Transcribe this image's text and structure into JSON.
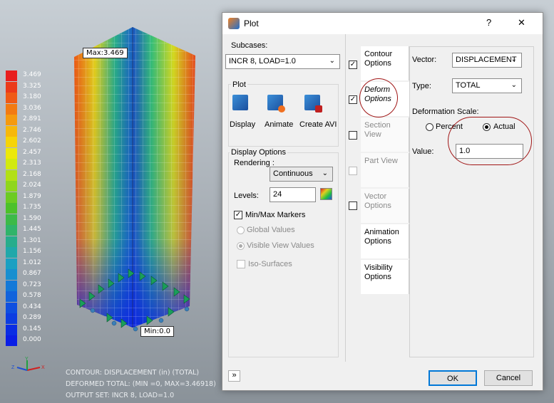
{
  "legend": {
    "values": [
      "3.469",
      "3.325",
      "3.180",
      "3.036",
      "2.891",
      "2.746",
      "2.602",
      "2.457",
      "2.313",
      "2.168",
      "2.024",
      "1.879",
      "1.735",
      "1.590",
      "1.445",
      "1.301",
      "1.156",
      "1.012",
      "0.867",
      "0.723",
      "0.578",
      "0.434",
      "0.289",
      "0.145",
      "0.000"
    ],
    "colors": [
      "#e81e1e",
      "#eb3a1a",
      "#ef5a16",
      "#f27a12",
      "#f59a0e",
      "#f7b80a",
      "#f6d407",
      "#ece80a",
      "#d2ea10",
      "#b2e016",
      "#8fd61c",
      "#6ccb22",
      "#4cc12a",
      "#3cba48",
      "#30b46a",
      "#27ad8c",
      "#20a8aa",
      "#1aa0c2",
      "#178fd0",
      "#1479d8",
      "#1163dc",
      "#0e4fe0",
      "#0c3de2",
      "#0a2de4",
      "#0a1ee6"
    ]
  },
  "markers": {
    "max_label": "Max:3.469",
    "min_label": "Min:0.0"
  },
  "info_lines": [
    "CONTOUR: DISPLACEMENT (in) (TOTAL)",
    "DEFORMED TOTAL: (MIN    =0, MAX=3.46918)",
    "OUTPUT SET: INCR 8, LOAD=1.0"
  ],
  "dialog": {
    "title": "Plot",
    "help": "?",
    "close": "✕",
    "subcases_label": "Subcases:",
    "subcase_value": "INCR 8, LOAD=1.0",
    "plot_group": "Plot",
    "display_label": "Display",
    "animate_label": "Animate",
    "create_avi_label": "Create AVI",
    "display_options_group": "Display Options",
    "rendering_label": "Rendering :",
    "rendering_value": "Continuous",
    "levels_label": "Levels:",
    "levels_value": "24",
    "minmax_label": "Min/Max Markers",
    "global_values": "Global Values",
    "visible_view_values": "Visible View Values",
    "iso_surfaces": "Iso-Surfaces",
    "tabs": [
      {
        "label1": "Contour",
        "label2": "Options"
      },
      {
        "label1": "Deform",
        "label2": "Options"
      },
      {
        "label1": "Section View",
        "label2": ""
      },
      {
        "label1": "Part View",
        "label2": ""
      },
      {
        "label1": "Vector",
        "label2": "Options"
      },
      {
        "label1": "Animation",
        "label2": "Options"
      },
      {
        "label1": "Visibility",
        "label2": "Options"
      }
    ],
    "vector_label": "Vector:",
    "vector_value": "DISPLACEMENT",
    "type_label": "Type:",
    "type_value": "TOTAL",
    "deformation_scale_label": "Deformation Scale:",
    "percent_label": "Percent",
    "actual_label": "Actual",
    "value_label": "Value:",
    "value_value": "1.0",
    "ok": "OK",
    "cancel": "Cancel",
    "collapse": "»"
  }
}
